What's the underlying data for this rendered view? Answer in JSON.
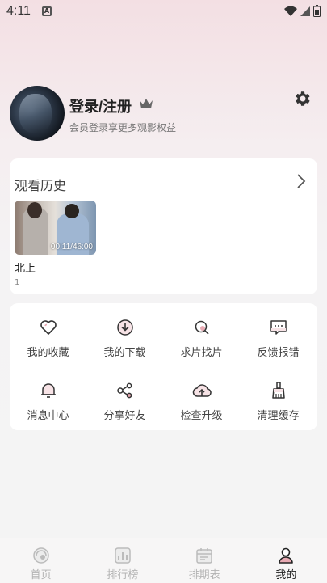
{
  "status": {
    "time": "4:11",
    "notif": "A"
  },
  "profile": {
    "title": "登录/注册",
    "subtitle": "会员登录享更多观影权益"
  },
  "history": {
    "title": "观看历史",
    "items": [
      {
        "name": "北上",
        "duration": "00:11/46:00",
        "episode": "1"
      }
    ]
  },
  "menu": {
    "items": [
      {
        "label": "我的收藏",
        "icon": "heart-icon"
      },
      {
        "label": "我的下载",
        "icon": "download-icon"
      },
      {
        "label": "求片找片",
        "icon": "search-film-icon"
      },
      {
        "label": "反馈报错",
        "icon": "feedback-icon"
      },
      {
        "label": "消息中心",
        "icon": "bell-icon"
      },
      {
        "label": "分享好友",
        "icon": "share-icon"
      },
      {
        "label": "检查升级",
        "icon": "upgrade-icon"
      },
      {
        "label": "清理缓存",
        "icon": "broom-icon"
      }
    ]
  },
  "tabs": [
    {
      "label": "首页",
      "icon": "home-icon",
      "active": false
    },
    {
      "label": "排行榜",
      "icon": "ranking-icon",
      "active": false
    },
    {
      "label": "排期表",
      "icon": "calendar-icon",
      "active": false
    },
    {
      "label": "我的",
      "icon": "profile-icon",
      "active": true
    }
  ],
  "colors": {
    "accent": "#e8aab3",
    "icon_stroke": "#333333",
    "inactive_tab": "#b3b3b3"
  }
}
